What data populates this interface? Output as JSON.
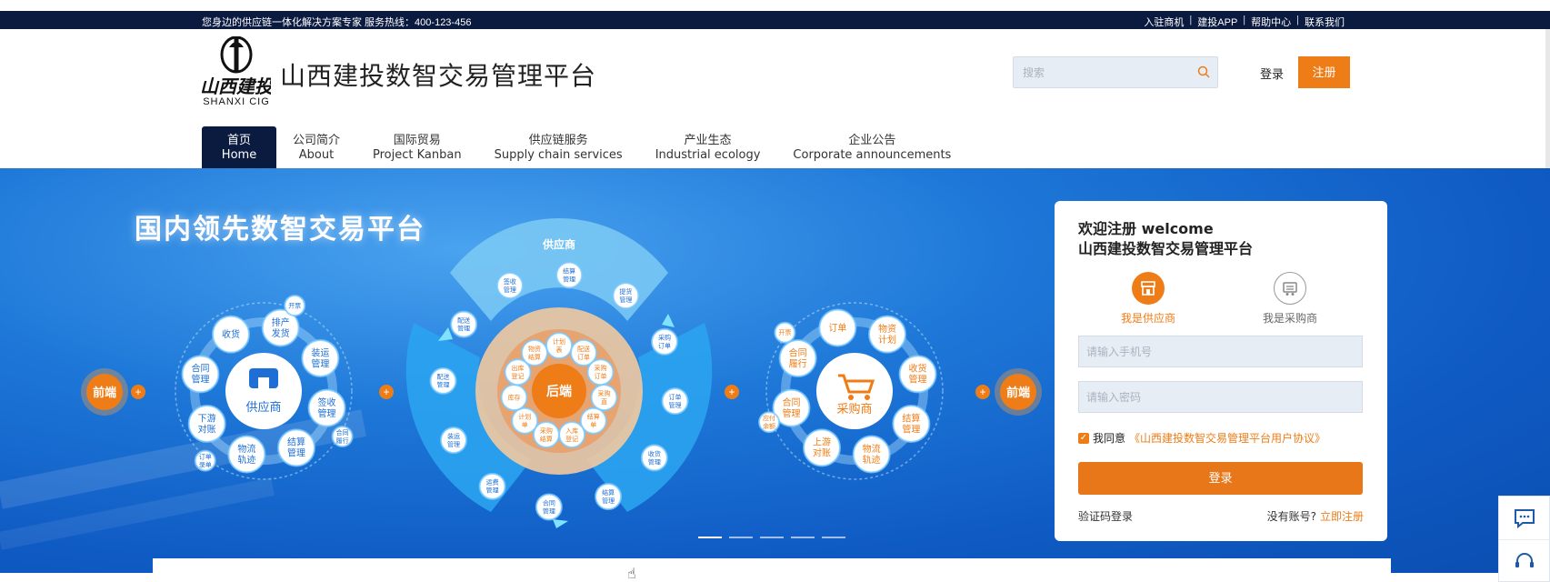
{
  "topbar": {
    "slogan": "您身边的供应链一体化解决方案专家 服务热线：400-123-456",
    "links": [
      "入驻商机",
      "建投APP",
      "帮助中心",
      "联系我们"
    ]
  },
  "header": {
    "logo_text": "SHANXI CIG",
    "title": "山西建投数智交易管理平台",
    "search_placeholder": "搜索",
    "login_label": "登录",
    "register_label": "注册"
  },
  "nav": [
    {
      "zh": "首页",
      "en": "Home",
      "active": true
    },
    {
      "zh": "公司简介",
      "en": "About"
    },
    {
      "zh": "国际贸易",
      "en": "Project Kanban"
    },
    {
      "zh": "供应链服务",
      "en": "Supply chain services"
    },
    {
      "zh": "产业生态",
      "en": "Industrial ecology"
    },
    {
      "zh": "企业公告",
      "en": "Corporate announcements"
    }
  ],
  "banner": {
    "headline": "国内领先数智交易平台",
    "front_label": "前端",
    "back_label": "后端",
    "supplier_hub": "供应商",
    "buyer_hub": "采购商",
    "supply_arc": "供应商",
    "left_nodes": [
      "排产发货",
      "装运管理",
      "签收管理",
      "结算管理",
      "物流轨迹",
      "下游对账",
      "合同管理",
      "收货",
      "开票",
      "合同履行",
      "订单录单"
    ],
    "right_nodes": [
      "物资计划",
      "收货管理",
      "结算管理",
      "物流轨迹",
      "上游对账",
      "合同管理",
      "合同履行",
      "订单",
      "应付余额",
      "开票"
    ],
    "center_ring": [
      "计划表",
      "配送订单",
      "采购订单",
      "采购直",
      "结算单",
      "入库登记",
      "采购结算",
      "计划单",
      "库存",
      "出库登记",
      "物资结算"
    ],
    "center_outer": [
      "配送管理",
      "签收管理",
      "结算管理",
      "提货管理",
      "采购订单",
      "订单管理",
      "收货管理",
      "结算管理",
      "合同管理",
      "运费管理",
      "装运管理",
      "配送管理"
    ],
    "carousel_count": 5,
    "carousel_active": 0
  },
  "login_card": {
    "welcome_line1": "欢迎注册 welcome",
    "welcome_line2": "山西建投数智交易管理平台",
    "role_supplier": "我是供应商",
    "role_buyer": "我是采购商",
    "phone_placeholder": "请输入手机号",
    "password_placeholder": "请输入密码",
    "agree_prefix": "我同意",
    "agree_link": "《山西建投数智交易管理平台用户协议》",
    "login_button": "登录",
    "code_login": "验证码登录",
    "no_account": "没有账号?",
    "register_now": "立即注册"
  },
  "colors": {
    "navy": "#0b1a3f",
    "orange": "#ef7d17",
    "banner_blue": "#1e78d8"
  }
}
